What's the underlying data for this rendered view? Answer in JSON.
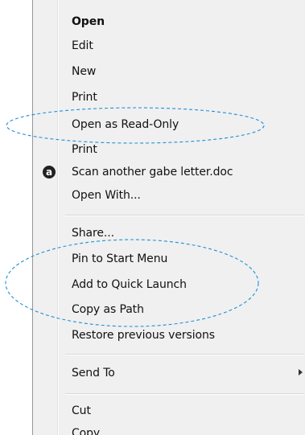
{
  "context_menu": {
    "items": [
      {
        "label": "Open",
        "bold": true
      },
      {
        "label": "Edit"
      },
      {
        "label": "New"
      },
      {
        "label": "Print"
      },
      {
        "label": "Open as Read-Only"
      },
      {
        "label": "Print"
      },
      {
        "label": "Scan another gabe letter.doc",
        "icon": "scan-badge-icon"
      },
      {
        "label": "Open With..."
      },
      {
        "label": "Share..."
      },
      {
        "label": "Pin to Start Menu"
      },
      {
        "label": "Add to Quick Launch"
      },
      {
        "label": "Copy as Path"
      },
      {
        "label": "Restore previous versions"
      },
      {
        "label": "Send To",
        "submenu": true
      },
      {
        "label": "Cut"
      },
      {
        "label": "Copy"
      }
    ]
  },
  "highlight_color": "#1e90d6",
  "menu_background": "#f0f0f0"
}
